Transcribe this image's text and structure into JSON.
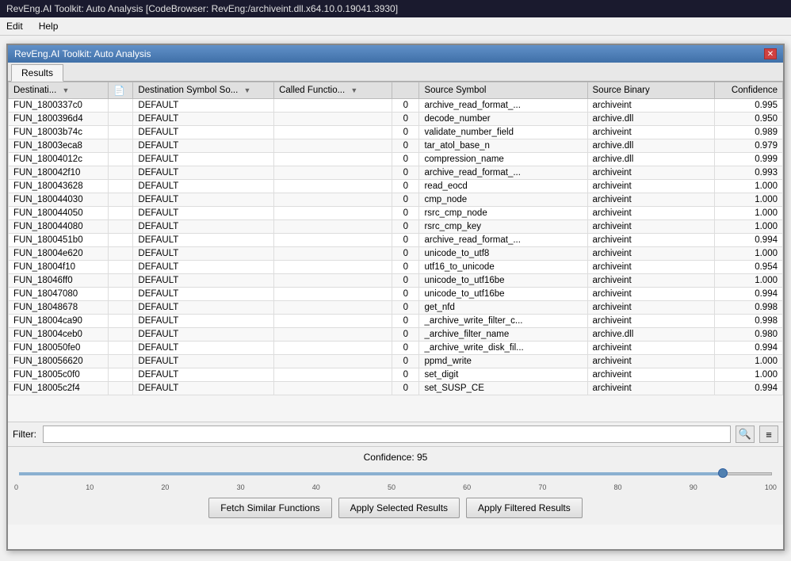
{
  "titlebar": {
    "text": "RevEng.AI Toolkit: Auto Analysis [CodeBrowser: RevEng:/archiveint.dll.x64.10.0.19041.3930]"
  },
  "menubar": {
    "items": [
      "Edit",
      "Help"
    ]
  },
  "dialog": {
    "title": "RevEng.AI Toolkit: Auto Analysis",
    "close_label": "✕"
  },
  "tabs": [
    {
      "label": "Results",
      "active": true
    }
  ],
  "table": {
    "columns": [
      {
        "label": "Destinati...",
        "key": "dest",
        "sort": true
      },
      {
        "label": "",
        "key": "dest_icon",
        "sort": false
      },
      {
        "label": "Destination Symbol So...",
        "key": "destso",
        "sort": true
      },
      {
        "label": "Called Functio...",
        "key": "calledfn",
        "sort": true
      },
      {
        "label": "",
        "key": "srcnum",
        "sort": false
      },
      {
        "label": "Source Symbol",
        "key": "src",
        "sort": false
      },
      {
        "label": "Source Binary",
        "key": "srcbin",
        "sort": false
      },
      {
        "label": "Confidence",
        "key": "conf",
        "sort": false
      }
    ],
    "rows": [
      {
        "dest": "FUN_1800337c0",
        "destso": "DEFAULT",
        "calledfn": "",
        "srcnum": "0",
        "src": "archive_read_format_...",
        "srcbin": "archiveint",
        "conf": "0.995"
      },
      {
        "dest": "FUN_1800396d4",
        "destso": "DEFAULT",
        "calledfn": "",
        "srcnum": "0",
        "src": "decode_number",
        "srcbin": "archive.dll",
        "conf": "0.950"
      },
      {
        "dest": "FUN_18003b74c",
        "destso": "DEFAULT",
        "calledfn": "",
        "srcnum": "0",
        "src": "validate_number_field",
        "srcbin": "archiveint",
        "conf": "0.989"
      },
      {
        "dest": "FUN_18003eca8",
        "destso": "DEFAULT",
        "calledfn": "",
        "srcnum": "0",
        "src": "tar_atol_base_n",
        "srcbin": "archive.dll",
        "conf": "0.979"
      },
      {
        "dest": "FUN_18004012c",
        "destso": "DEFAULT",
        "calledfn": "",
        "srcnum": "0",
        "src": "compression_name",
        "srcbin": "archive.dll",
        "conf": "0.999"
      },
      {
        "dest": "FUN_180042f10",
        "destso": "DEFAULT",
        "calledfn": "",
        "srcnum": "0",
        "src": "archive_read_format_...",
        "srcbin": "archiveint",
        "conf": "0.993"
      },
      {
        "dest": "FUN_180043628",
        "destso": "DEFAULT",
        "calledfn": "",
        "srcnum": "0",
        "src": "read_eocd",
        "srcbin": "archiveint",
        "conf": "1.000"
      },
      {
        "dest": "FUN_180044030",
        "destso": "DEFAULT",
        "calledfn": "",
        "srcnum": "0",
        "src": "cmp_node",
        "srcbin": "archiveint",
        "conf": "1.000"
      },
      {
        "dest": "FUN_180044050",
        "destso": "DEFAULT",
        "calledfn": "",
        "srcnum": "0",
        "src": "rsrc_cmp_node",
        "srcbin": "archiveint",
        "conf": "1.000"
      },
      {
        "dest": "FUN_180044080",
        "destso": "DEFAULT",
        "calledfn": "",
        "srcnum": "0",
        "src": "rsrc_cmp_key",
        "srcbin": "archiveint",
        "conf": "1.000"
      },
      {
        "dest": "FUN_1800451b0",
        "destso": "DEFAULT",
        "calledfn": "",
        "srcnum": "0",
        "src": "archive_read_format_...",
        "srcbin": "archiveint",
        "conf": "0.994"
      },
      {
        "dest": "FUN_18004e620",
        "destso": "DEFAULT",
        "calledfn": "",
        "srcnum": "0",
        "src": "unicode_to_utf8",
        "srcbin": "archiveint",
        "conf": "1.000"
      },
      {
        "dest": "FUN_18004f10",
        "destso": "DEFAULT",
        "calledfn": "",
        "srcnum": "0",
        "src": "utf16_to_unicode",
        "srcbin": "archiveint",
        "conf": "0.954"
      },
      {
        "dest": "FUN_18046ff0",
        "destso": "DEFAULT",
        "calledfn": "",
        "srcnum": "0",
        "src": "unicode_to_utf16be",
        "srcbin": "archiveint",
        "conf": "1.000"
      },
      {
        "dest": "FUN_18047080",
        "destso": "DEFAULT",
        "calledfn": "",
        "srcnum": "0",
        "src": "unicode_to_utf16be",
        "srcbin": "archiveint",
        "conf": "0.994"
      },
      {
        "dest": "FUN_18048678",
        "destso": "DEFAULT",
        "calledfn": "",
        "srcnum": "0",
        "src": "get_nfd",
        "srcbin": "archiveint",
        "conf": "0.998"
      },
      {
        "dest": "FUN_18004ca90",
        "destso": "DEFAULT",
        "calledfn": "",
        "srcnum": "0",
        "src": "_archive_write_filter_c...",
        "srcbin": "archiveint",
        "conf": "0.998"
      },
      {
        "dest": "FUN_18004ceb0",
        "destso": "DEFAULT",
        "calledfn": "",
        "srcnum": "0",
        "src": "_archive_filter_name",
        "srcbin": "archive.dll",
        "conf": "0.980"
      },
      {
        "dest": "FUN_180050fe0",
        "destso": "DEFAULT",
        "calledfn": "",
        "srcnum": "0",
        "src": "_archive_write_disk_fil...",
        "srcbin": "archiveint",
        "conf": "0.994"
      },
      {
        "dest": "FUN_180056620",
        "destso": "DEFAULT",
        "calledfn": "",
        "srcnum": "0",
        "src": "ppmd_write",
        "srcbin": "archiveint",
        "conf": "1.000"
      },
      {
        "dest": "FUN_18005c0f0",
        "destso": "DEFAULT",
        "calledfn": "",
        "srcnum": "0",
        "src": "set_digit",
        "srcbin": "archiveint",
        "conf": "1.000"
      },
      {
        "dest": "FUN_18005c2f4",
        "destso": "DEFAULT",
        "calledfn": "",
        "srcnum": "0",
        "src": "set_SUSP_CE",
        "srcbin": "archiveint",
        "conf": "0.994"
      }
    ]
  },
  "filter": {
    "label": "Filter:",
    "placeholder": "",
    "value": "",
    "icon1": "🔍",
    "icon2": "≡"
  },
  "confidence": {
    "label": "Confidence: 95",
    "slider_value": 95,
    "ticks": [
      "0",
      "10",
      "20",
      "30",
      "40",
      "50",
      "60",
      "70",
      "80",
      "90",
      "100"
    ]
  },
  "buttons": {
    "fetch": "Fetch Similar Functions",
    "selected": "Apply Selected Results",
    "filtered": "Apply Filtered Results"
  }
}
